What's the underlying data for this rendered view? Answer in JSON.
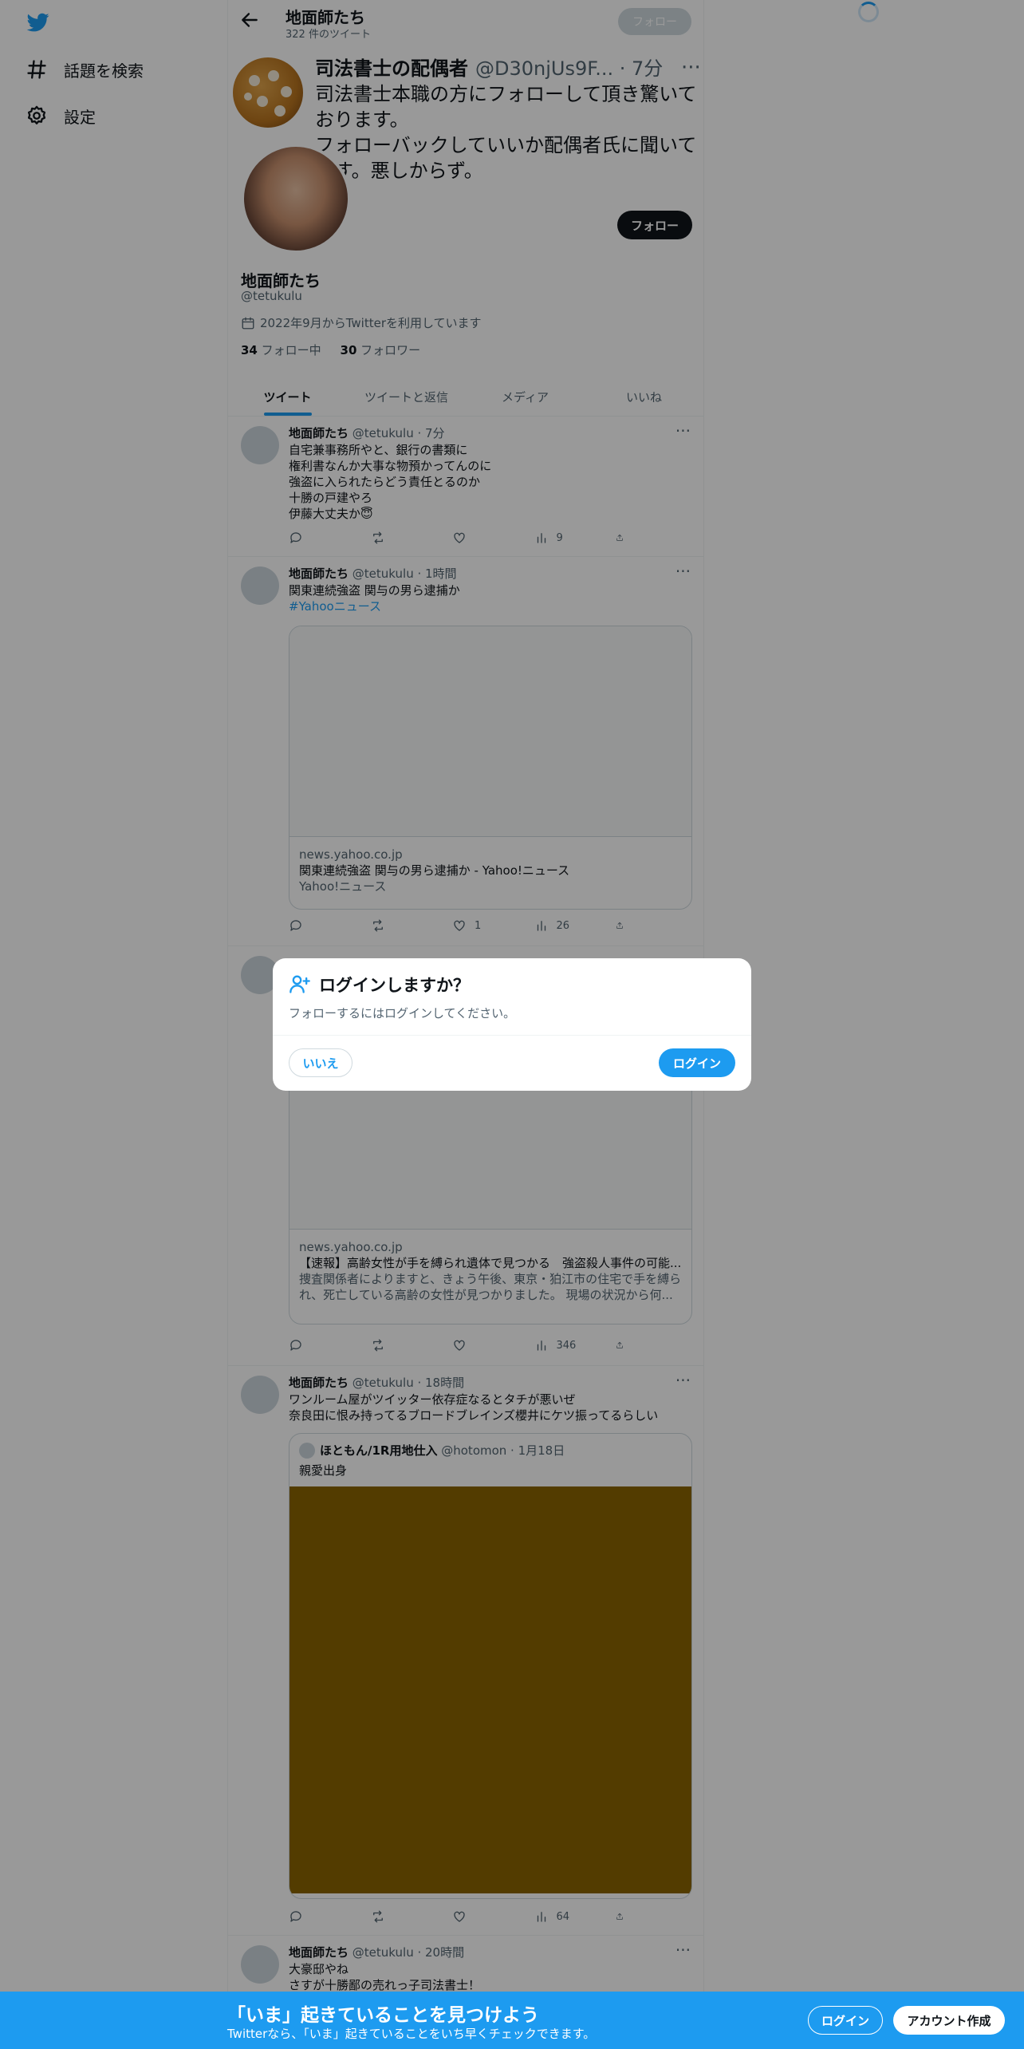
{
  "nav": {
    "logo_icon": "twitter-bird-icon",
    "items": [
      {
        "icon": "hashtag-icon",
        "label": "話題を検索"
      },
      {
        "icon": "gear-icon",
        "label": "設定"
      }
    ]
  },
  "header": {
    "title": "地面師たち",
    "tweet_count": "322 件のツイート",
    "follow_label": "フォロー"
  },
  "pinned_overlay": {
    "name": "司法書士の配偶者",
    "handle_time": "@D30njUs9F... · 7分",
    "text": "司法書士本職の方にフォローして頂き驚いております。\nフォローバックしていいか配偶者氏に聞いてます。悪しからず。"
  },
  "profile": {
    "follow_label": "フォロー",
    "name": "地面師たち",
    "handle": "@tetukulu",
    "joined": "2022年9月からTwitterを利用しています",
    "following_count": "34",
    "following_label": "フォロー中",
    "followers_count": "30",
    "followers_label": "フォロワー"
  },
  "tabs": [
    "ツイート",
    "ツイートと返信",
    "メディア",
    "いいね"
  ],
  "tweets": [
    {
      "name": "地面師たち",
      "handle_time": "@tetukulu · 7分",
      "text": "自宅兼事務所やと、銀行の書類に\n権利書なんか大事な物預かってんのに\n強盗に入られたらどう責任とるのか\n十勝の戸建やろ\n伊藤大丈夫か😇",
      "stats": {
        "reply": "",
        "retweet": "",
        "like": "",
        "views": "9"
      }
    },
    {
      "name": "地面師たち",
      "handle_time": "@tetukulu · 1時間",
      "text": "関東連続強盗 関与の男ら逮捕か",
      "link": "#Yahooニュース",
      "card": {
        "domain": "news.yahoo.co.jp",
        "title": "関東連続強盗 関与の男ら逮捕か - Yahoo!ニュース",
        "source": "Yahoo!ニュース"
      },
      "stats": {
        "reply": "",
        "retweet": "",
        "like": "1",
        "views": "26"
      }
    },
    {
      "card": {
        "domain": "news.yahoo.co.jp",
        "title": "【速報】高齢女性が手を縛られ遺体で見つかる　強盗殺人事件の可能...",
        "desc1": "捜査関係者によりますと、きょう午後、東京・狛江市の住宅で手を縛ら",
        "desc2": "れ、死亡している高齢の女性が見つかりました。 現場の状況から何..."
      },
      "stats": {
        "reply": "",
        "retweet": "",
        "like": "",
        "views": "346"
      }
    },
    {
      "name": "地面師たち",
      "handle_time": "@tetukulu · 18時間",
      "text": "ワンルーム屋がツイッター依存症なるとタチが悪いぜ\n奈良田に恨み持ってるブロードブレインズ櫻井にケツ振ってるらしい",
      "quote": {
        "name": "ほともん/1R用地仕入",
        "handle_time": "@hotomon · 1月18日",
        "text": "親愛出身"
      },
      "stats": {
        "reply": "",
        "retweet": "",
        "like": "",
        "views": "64"
      }
    },
    {
      "name": "地面師たち",
      "handle_time": "@tetukulu · 20時間",
      "text": "大豪邸やね\nさすが十勝鄙の売れっ子司法書士！"
    }
  ],
  "modal": {
    "icon": "person-add-icon",
    "title": "ログインしますか？",
    "body": "フォローするにはログインしてください。",
    "no_label": "いいえ",
    "yes_label": "ログイン"
  },
  "bottom_bar": {
    "title": "「いま」起きていることを見つけよう",
    "subtitle": "Twitterなら、「いま」起きていることをいち早くチェックできます。",
    "login_label": "ログイン",
    "signup_label": "アカウント作成"
  }
}
